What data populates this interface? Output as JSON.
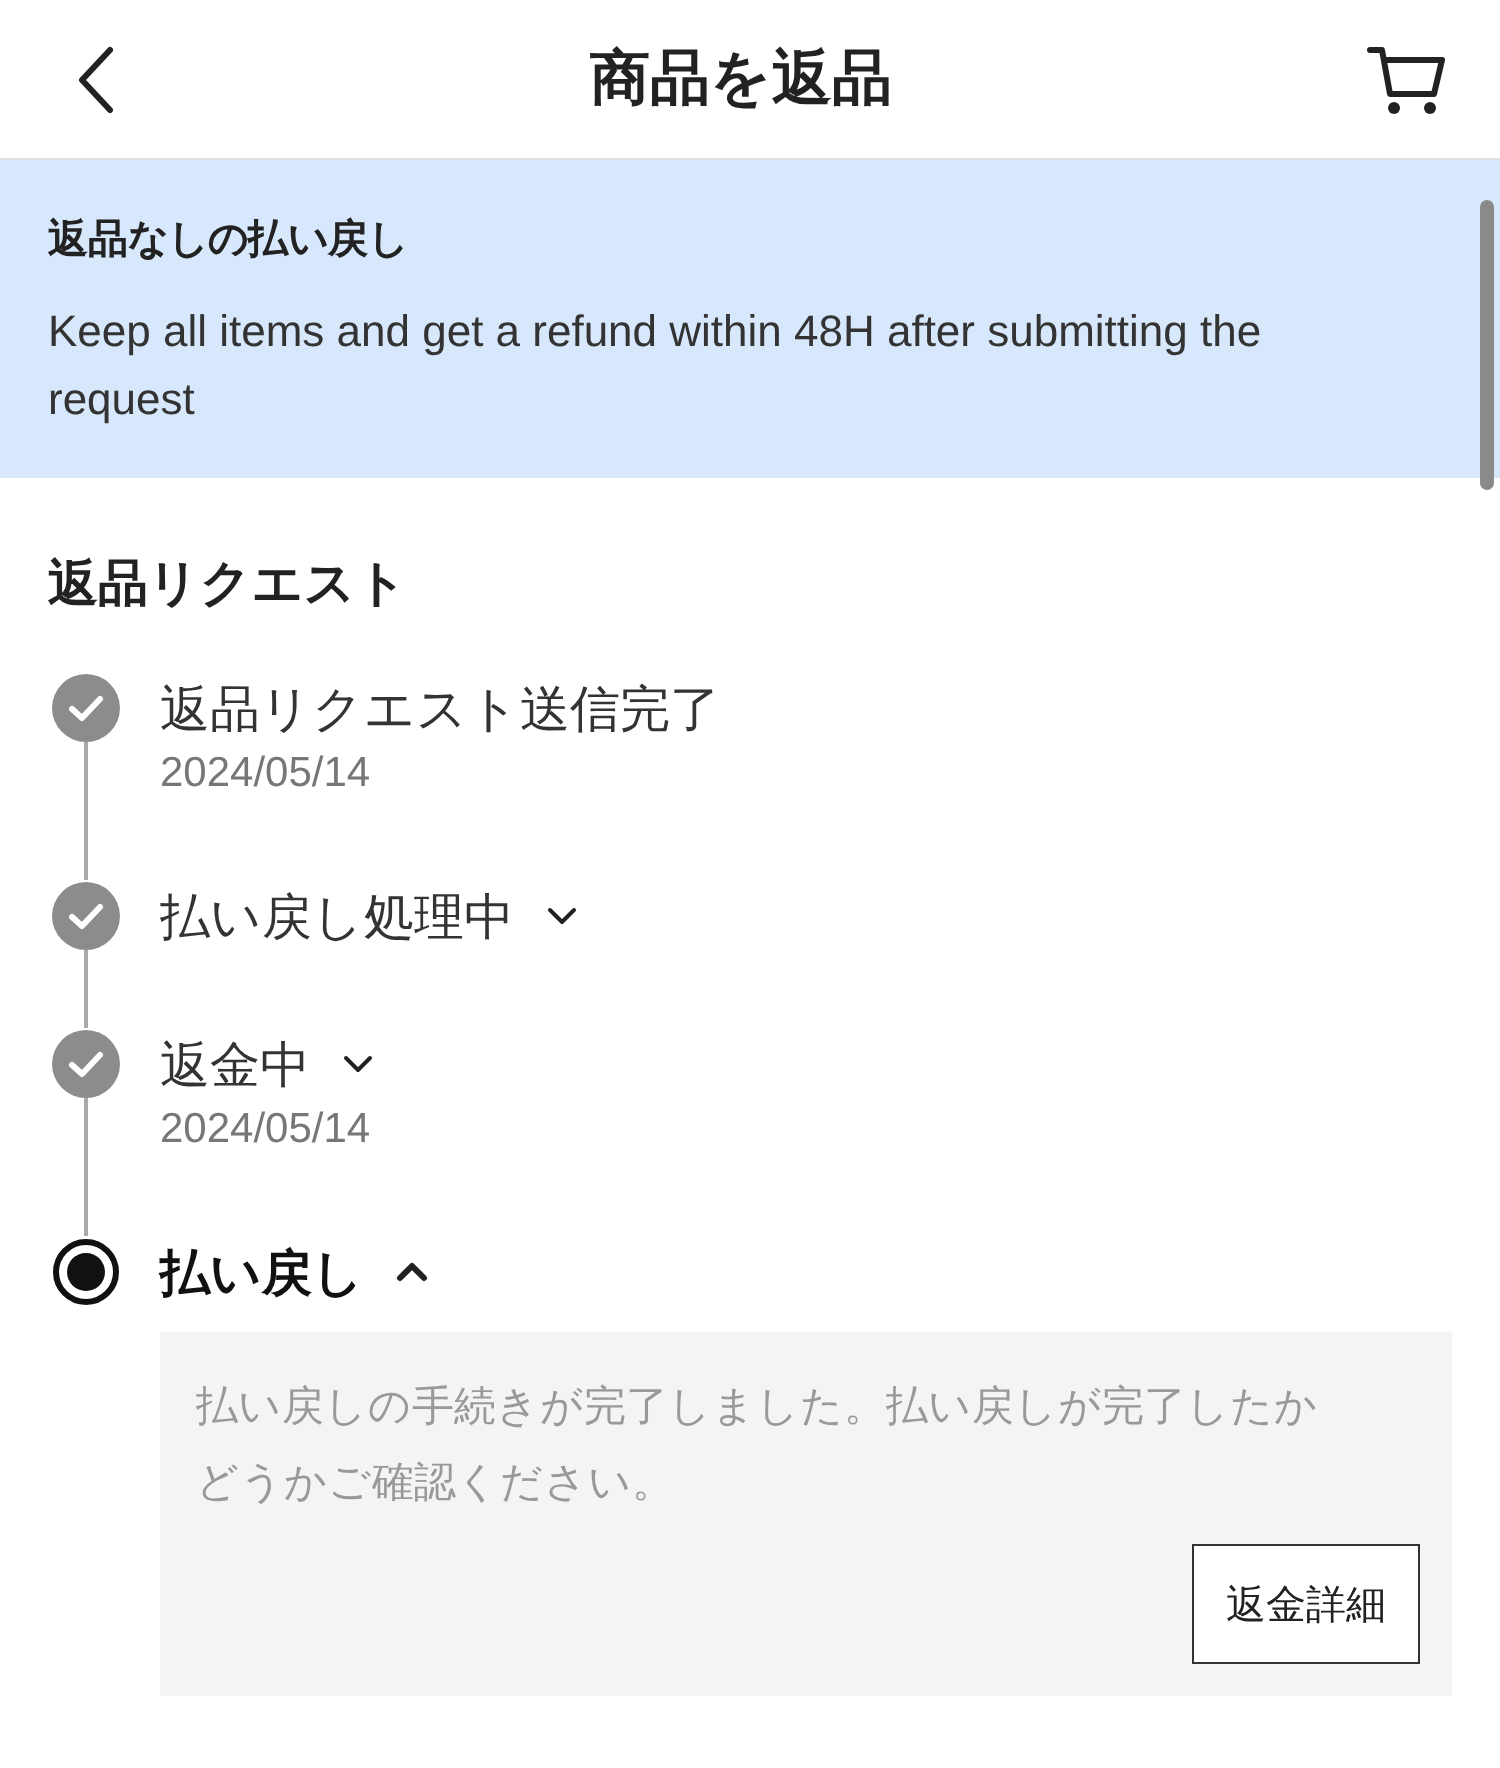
{
  "header": {
    "title": "商品を返品"
  },
  "banner": {
    "title": "返品なしの払い戻し",
    "text": "Keep all items and get a refund within 48H after submitting the request"
  },
  "section_title": "返品リクエスト",
  "steps": [
    {
      "title": "返品リクエスト送信完了",
      "date": "2024/05/14",
      "kind": "done"
    },
    {
      "title": "払い戻し処理中",
      "kind": "done",
      "expanded": false
    },
    {
      "title": "返金中",
      "date": "2024/05/14",
      "kind": "done",
      "expanded": false
    },
    {
      "title": "払い戻し",
      "kind": "current",
      "expanded": true,
      "detail": "払い戻しの手続きが完了しました。払い戻しが完了したかどうかご確認ください。",
      "button": "返金詳細"
    }
  ]
}
